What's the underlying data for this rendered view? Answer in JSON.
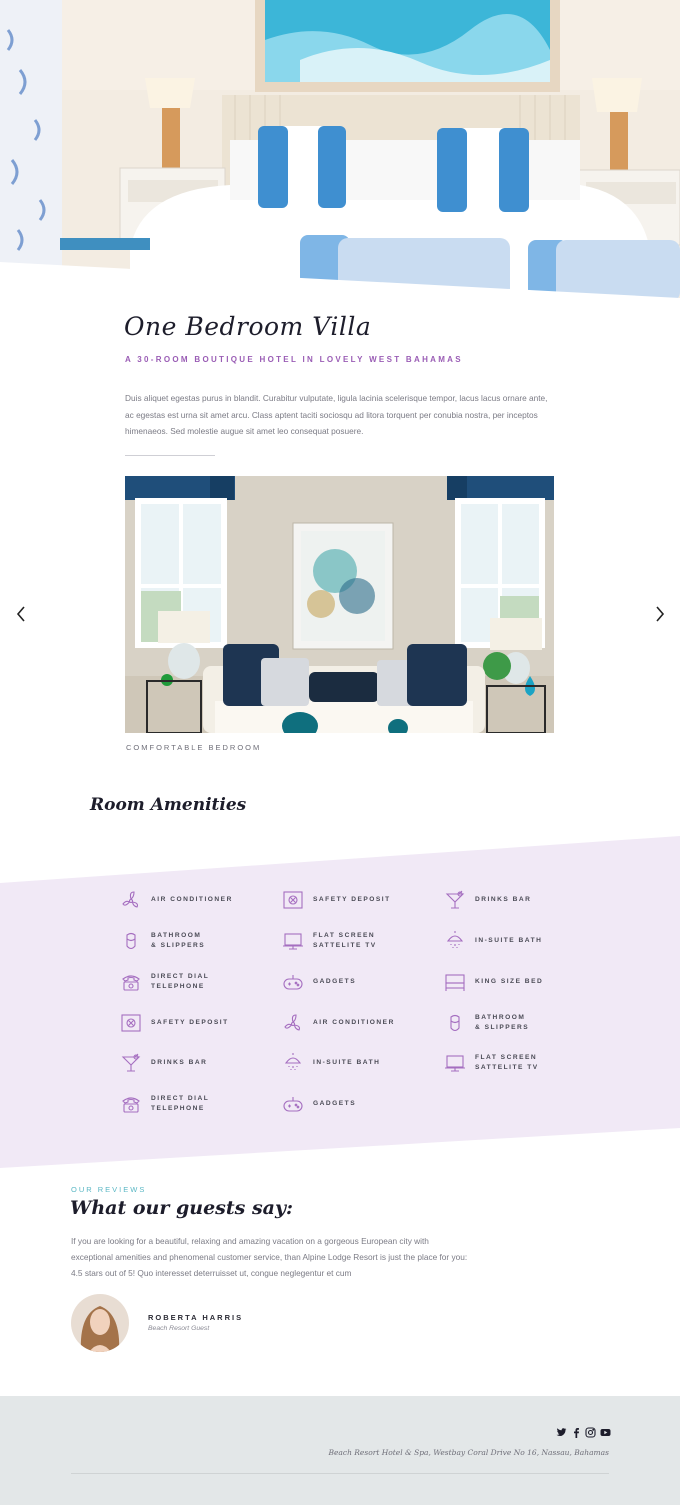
{
  "hero": {
    "image_alt": "Bedroom with blue and white striped pillows"
  },
  "villa": {
    "title": "One Bedroom Villa",
    "subtitle": "A 30-ROOM BOUTIQUE HOTEL IN LOVELY WEST BAHAMAS",
    "description": "Duis aliquet egestas purus in blandit. Curabitur vulputate, ligula lacinia scelerisque tempor, lacus lacus ornare ante, ac egestas est urna sit amet arcu. Class aptent taciti sociosqu ad litora torquent per conubia nostra, per inceptos himenaeos. Sed molestie augue sit amet leo consequat posuere."
  },
  "gallery": {
    "caption": "COMFORTABLE BEDROOM",
    "prev_icon": "chevron-left-icon",
    "next_icon": "chevron-right-icon"
  },
  "amenities": {
    "title": "Room Amenities",
    "items": [
      {
        "label": "AIR CONDITIONER",
        "icon": "fan-icon"
      },
      {
        "label": "SAFETY DEPOSIT",
        "icon": "safe-icon"
      },
      {
        "label": "DRINKS BAR",
        "icon": "cocktail-icon"
      },
      {
        "label": "BATHROOM\n& SLIPPERS",
        "icon": "slipper-icon"
      },
      {
        "label": "FLAT SCREEN\nSATTELITE TV",
        "icon": "tv-icon"
      },
      {
        "label": "IN-SUITE BATH",
        "icon": "shower-icon"
      },
      {
        "label": "DIRECT DIAL\nTELEPHONE",
        "icon": "telephone-icon"
      },
      {
        "label": "GADGETS",
        "icon": "gamepad-icon"
      },
      {
        "label": "KING SIZE BED",
        "icon": "bed-icon"
      },
      {
        "label": "SAFETY DEPOSIT",
        "icon": "safe-icon"
      },
      {
        "label": "AIR CONDITIONER",
        "icon": "fan-icon"
      },
      {
        "label": "BATHROOM\n& SLIPPERS",
        "icon": "slipper-icon"
      },
      {
        "label": "DRINKS BAR",
        "icon": "cocktail-icon"
      },
      {
        "label": "IN-SUITE BATH",
        "icon": "shower-icon"
      },
      {
        "label": "FLAT SCREEN\nSATTELITE TV",
        "icon": "tv-icon"
      },
      {
        "label": "DIRECT DIAL\nTELEPHONE",
        "icon": "telephone-icon"
      },
      {
        "label": "GADGETS",
        "icon": "gamepad-icon"
      }
    ]
  },
  "reviews": {
    "kicker": "OUR REVIEWS",
    "title": "What our guests say:",
    "text": "If you are looking for a beautiful, relaxing and amazing vacation on a gorgeous European city with exceptional amenities and phenomenal customer service, than Alpine Lodge Resort is just the place for you: 4.5 stars out of 5! Quo interesset deterruisset ut, congue neglegentur et cum",
    "name": "ROBERTA HARRIS",
    "role": "Beach Resort Guest"
  },
  "footer": {
    "address": "Beach Resort Hotel & Spa, Westbay Coral Drive No 16, Nassau, Bahamas",
    "social": [
      "twitter-icon",
      "facebook-icon",
      "instagram-icon",
      "youtube-icon"
    ]
  },
  "colors": {
    "accent_purple": "#9a5db5",
    "amenity_bg": "#f1e9f6",
    "review_kicker": "#5ab7c4",
    "footer_bg": "#e3e7e8"
  }
}
